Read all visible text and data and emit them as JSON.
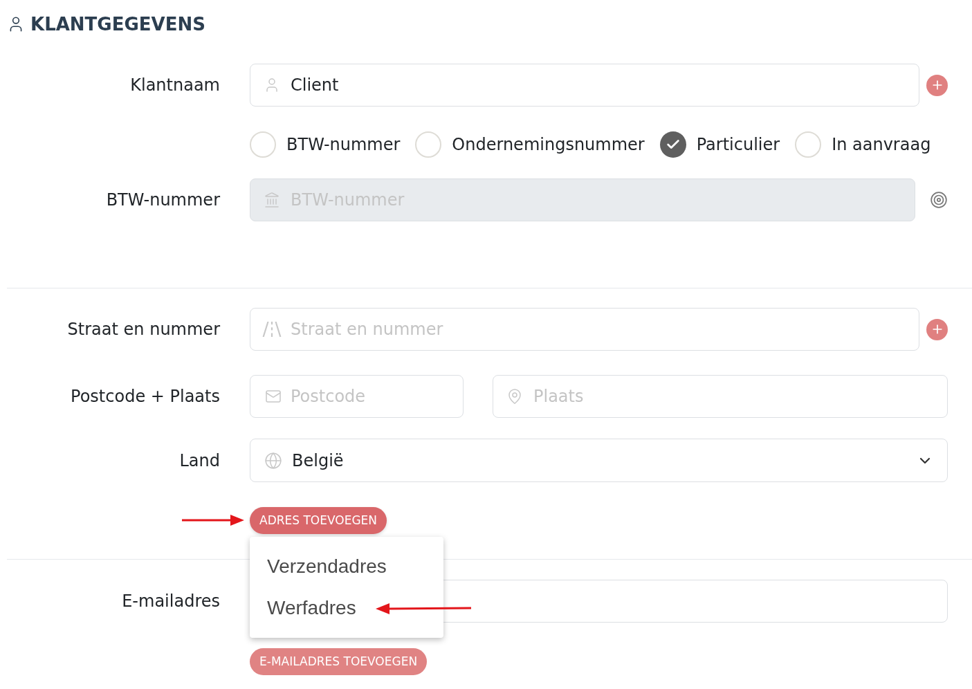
{
  "section": {
    "title": "KLANTGEGEVENS"
  },
  "client_name": {
    "label": "Klantnaam",
    "value": "Client"
  },
  "identification_types": [
    {
      "label": "BTW-nummer",
      "selected": false
    },
    {
      "label": "Ondernemingsnummer",
      "selected": false
    },
    {
      "label": "Particulier",
      "selected": true
    },
    {
      "label": "In aanvraag",
      "selected": false
    }
  ],
  "vat_number": {
    "label": "BTW-nummer",
    "placeholder": "BTW-nummer",
    "disabled": true
  },
  "address": {
    "street": {
      "label": "Straat en nummer",
      "placeholder": "Straat en nummer"
    },
    "postcode_city": {
      "label": "Postcode + Plaats",
      "postcode_placeholder": "Postcode",
      "city_placeholder": "Plaats"
    },
    "country": {
      "label": "Land",
      "value": "België"
    },
    "add_button": {
      "label": "ADRES TOEVOEGEN",
      "expanded": true
    },
    "menu": {
      "items": [
        {
          "label": "Verzendadres"
        },
        {
          "label": "Werfadres"
        }
      ]
    }
  },
  "email": {
    "label": "E-mailadres",
    "add_button": {
      "label": "E-MAILADRES TOEVOEGEN",
      "expanded": false
    }
  }
}
